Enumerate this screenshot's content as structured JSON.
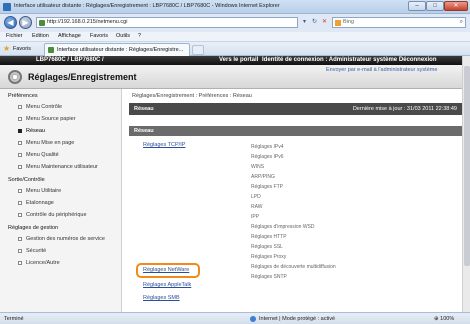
{
  "window": {
    "title": "Interface utilisateur distante : Réglages/Enregistrement : LBP7680C / LBP7680C - Windows Internet Explorer",
    "minimize": "–",
    "maximize": "□",
    "close": "✕"
  },
  "address": {
    "url": "http://192.168.0.215/netmenu.cgi",
    "search_placeholder": "Bing"
  },
  "menu": [
    "Fichier",
    "Edition",
    "Affichage",
    "Favoris",
    "Outils",
    "?"
  ],
  "favorites_label": "Favoris",
  "tab_title": "Interface utilisateur distante : Réglages/Enregistre...",
  "header": {
    "model": "LBP7680C / LBP7680C /",
    "portal_link": "Vers le portail",
    "identity": "Identité de connexion : Administrateur système",
    "logout": "Déconnexion",
    "page_title": "Réglages/Enregistrement",
    "email_link": "Envoyer par e-mail à l'administrateur système"
  },
  "sidebar": {
    "sections": [
      {
        "label": "Préférences",
        "items": [
          "Menu Contrôle",
          "Menu Source papier",
          "Réseau",
          "Menu Mise en page",
          "Menu Qualité",
          "Menu Maintenance utilisateur"
        ]
      },
      {
        "label": "Sortie/Contrôle",
        "items": [
          "Menu Utilitaire",
          "Etalonnage",
          "Contrôle du périphérique"
        ]
      },
      {
        "label": "Réglages de gestion",
        "items": [
          "Gestion des numéros de service",
          "Sécurité",
          "Licence/Autre"
        ]
      }
    ],
    "active_item": "Réseau"
  },
  "content": {
    "breadcrumb": "Réglages/Enregistrement : Préférences : Réseau",
    "bar_title": "Réseau",
    "last_update": "Dernière mise à jour : 31/03 2011 22:38:49",
    "section_title": "Réseau",
    "tcpip_link": "Réglages TCP/IP",
    "tcpip_subitems": [
      "Réglages IPv4",
      "Réglages IPv6",
      "WINS",
      "ARP/PING",
      "Réglages FTP",
      "LPD",
      "RAW",
      "IPP",
      "Réglages d'impression WSD",
      "Réglages HTTP",
      "Réglages SSL",
      "Réglages Proxy",
      "Réglages de découverte multidiffusion",
      "Réglages SNTP"
    ],
    "netware_link": "Réglages NetWare",
    "appletalk_link": "Réglages AppleTalk",
    "smb_link": "Réglages SMB"
  },
  "status": {
    "left": "Terminé",
    "zone": "Internet | Mode protégé : activé",
    "zoom": "100%"
  }
}
